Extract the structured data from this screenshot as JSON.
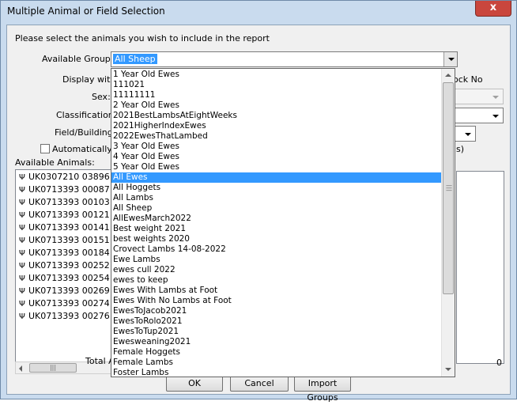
{
  "window": {
    "title": "Multiple Animal or Field Selection",
    "close_label": "x"
  },
  "instruction": "Please select the animals you wish to include in the report",
  "labels": {
    "available_groups": "Available Groups:",
    "display_with": "Display with:",
    "sex": "Sex:",
    "classification": "Classification:",
    "field_building": "Field/Building:",
    "auto_include": "Automatically in",
    "available_animals": "Available Animals:",
    "total": "Total A",
    "right_header": "ock No",
    "right_s": "s)",
    "total_count": "0"
  },
  "groups_combo": {
    "value": "All Sheep"
  },
  "dropdown_items": [
    "1 Year Old Ewes",
    "111021",
    "11111111",
    "2 Year Old Ewes",
    "2021BestLambsAtEightWeeks",
    "2021HigherIndexEwes",
    "2022EwesThatLambed",
    "3 Year Old Ewes",
    "4 Year Old Ewes",
    "5 Year Old Ewes",
    "All Ewes",
    "All Hoggets",
    "All Lambs",
    "All Sheep",
    "AllEwesMarch2022",
    "Best weight 2021",
    "best weights 2020",
    "Crovect Lambs 14-08-2022",
    "Ewe Lambs",
    "ewes cull 2022",
    "ewes to keep",
    "Ewes With Lambs at Foot",
    "Ewes With No Lambs at Foot",
    "EwesToJacob2021",
    "EwesToRolo2021",
    "EwesToTup2021",
    "Ewesweaning2021",
    "Female Hoggets",
    "Female Lambs",
    "Foster Lambs"
  ],
  "dropdown_selected": "All Ewes",
  "animals": [
    "UK0307210 03896",
    "UK0713393 00087",
    "UK0713393 00103",
    "UK0713393 00121",
    "UK0713393 00141",
    "UK0713393 00151",
    "UK0713393 00184",
    "UK0713393 00252",
    "UK0713393 00254",
    "UK0713393 00269",
    "UK0713393 00274",
    "UK0713393 00276"
  ],
  "buttons": {
    "ok": "OK",
    "cancel": "Cancel",
    "import": "Import Groups"
  },
  "colors": {
    "selection": "#3399ff",
    "close": "#c9463d",
    "frame": "#c9dbee"
  }
}
